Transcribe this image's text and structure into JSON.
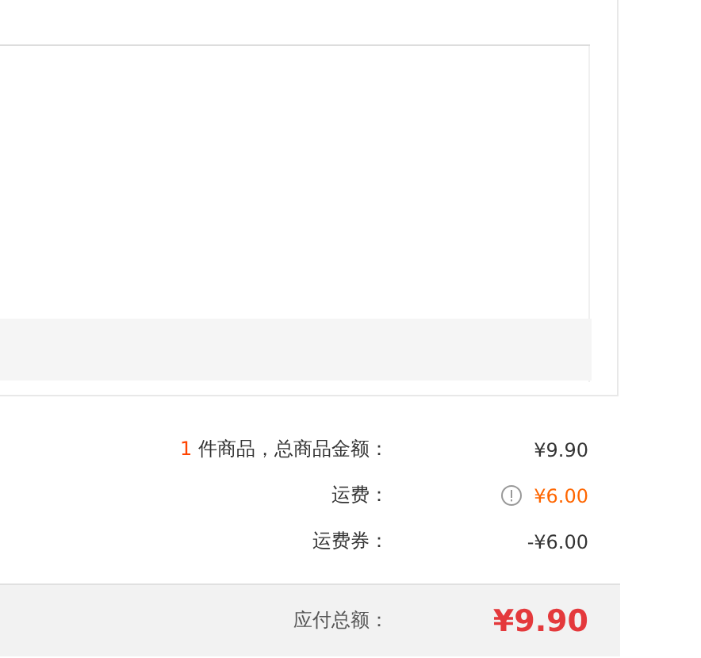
{
  "summary": {
    "rows": [
      {
        "kind": "count",
        "count": "1",
        "label": "件商品，总商品金额：",
        "value": "¥9.90",
        "info": false
      },
      {
        "kind": "highlight",
        "label": "运费：",
        "value": "¥6.00",
        "info": true
      },
      {
        "kind": "plain",
        "label": "运费券：",
        "value": "-¥6.00",
        "info": false
      }
    ]
  },
  "total": {
    "label": "应付总额：",
    "value": "¥9.90"
  }
}
